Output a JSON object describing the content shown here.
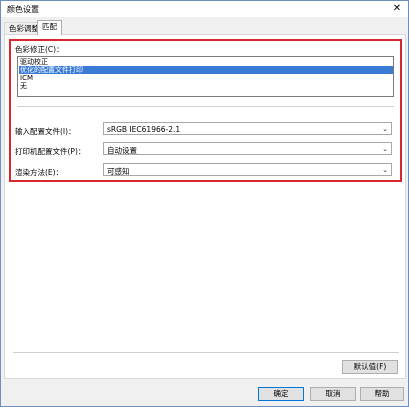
{
  "window": {
    "title": "颜色设置",
    "close_glyph": "✕"
  },
  "tabs": [
    {
      "label": "色彩调整",
      "active": false
    },
    {
      "label": "匹配",
      "active": true
    }
  ],
  "color_correction": {
    "label": "色彩修正(C)：",
    "items": [
      {
        "label": "驱动校正",
        "selected": false
      },
      {
        "label": "优化的配置文件打印",
        "selected": true
      },
      {
        "label": "ICM",
        "selected": false
      },
      {
        "label": "无",
        "selected": false
      }
    ]
  },
  "fields": {
    "input_profile": {
      "label": "输入配置文件(I)：",
      "value": "sRGB IEC61966-2.1"
    },
    "printer_profile": {
      "label": "打印机配置文件(P)：",
      "value": "自动设置"
    },
    "rendering_intent": {
      "label": "渲染方法(E)：",
      "value": "可感知"
    }
  },
  "buttons": {
    "defaults": "默认值(F)",
    "ok": "确定",
    "cancel": "取消",
    "help": "帮助"
  },
  "colors": {
    "highlight": "#d9272e",
    "selection": "#3a7bd5"
  }
}
